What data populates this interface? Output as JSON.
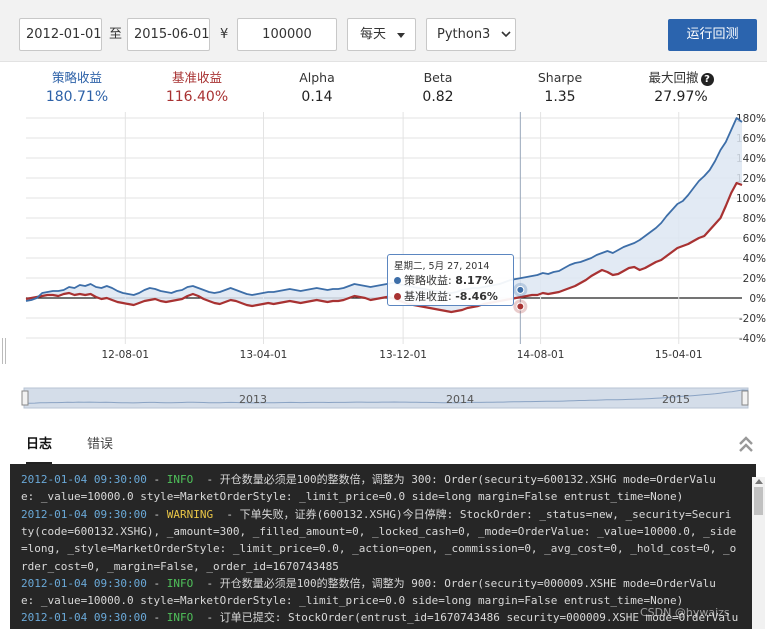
{
  "toolbar": {
    "start_date": "2012-01-01",
    "to_label": "至",
    "end_date": "2015-06-01",
    "currency_symbol": "¥",
    "capital": "100000",
    "frequency": "每天",
    "language": "Python3",
    "run_button": "运行回测"
  },
  "stats": [
    {
      "label": "策略收益",
      "value": "180.71%",
      "color": "#2e62a8"
    },
    {
      "label": "基准收益",
      "value": "116.40%",
      "color": "#a83232"
    },
    {
      "label": "Alpha",
      "value": "0.14",
      "color": "#222222"
    },
    {
      "label": "Beta",
      "value": "0.82",
      "color": "#222222"
    },
    {
      "label": "Sharpe",
      "value": "1.35",
      "color": "#222222"
    },
    {
      "label": "最大回撤",
      "value": "27.97%",
      "color": "#222222"
    }
  ],
  "chart_data": {
    "type": "line",
    "y_unit": "%",
    "ylim": [
      -40,
      180
    ],
    "yticks": [
      "-40%",
      "-20%",
      "0%",
      "20%",
      "40%",
      "60%",
      "80%",
      "100%",
      "120%",
      "140%",
      "160%",
      "180%"
    ],
    "xticks": [
      "12-08-01",
      "13-04-01",
      "13-12-01",
      "14-08-01",
      "15-04-01"
    ],
    "navigator_labels": [
      "2013",
      "2014",
      "2015"
    ],
    "grid": true,
    "legend": "none",
    "colors": {
      "strategy": "#3d6ea8",
      "benchmark": "#a83232",
      "area": "#dde6f2"
    },
    "series": [
      {
        "name": "策略收益",
        "points": [
          [
            0,
            -3
          ],
          [
            1,
            -2
          ],
          [
            2,
            0
          ],
          [
            3,
            5
          ],
          [
            4,
            6
          ],
          [
            5,
            7
          ],
          [
            6,
            7
          ],
          [
            7,
            8
          ],
          [
            8,
            11
          ],
          [
            9,
            10
          ],
          [
            10,
            13
          ],
          [
            11,
            12
          ],
          [
            12,
            14
          ],
          [
            13,
            11
          ],
          [
            14,
            10
          ],
          [
            15,
            12
          ],
          [
            16,
            10
          ],
          [
            17,
            7
          ],
          [
            18,
            5
          ],
          [
            19,
            4
          ],
          [
            20,
            3
          ],
          [
            21,
            5
          ],
          [
            22,
            8
          ],
          [
            23,
            10
          ],
          [
            24,
            9
          ],
          [
            25,
            7
          ],
          [
            26,
            6
          ],
          [
            27,
            5
          ],
          [
            28,
            7
          ],
          [
            29,
            8
          ],
          [
            30,
            11
          ],
          [
            31,
            12
          ],
          [
            32,
            10
          ],
          [
            33,
            8
          ],
          [
            34,
            6
          ],
          [
            35,
            5
          ],
          [
            36,
            6
          ],
          [
            37,
            8
          ],
          [
            38,
            10
          ],
          [
            39,
            8
          ],
          [
            40,
            6
          ],
          [
            41,
            4
          ],
          [
            42,
            3
          ],
          [
            43,
            4
          ],
          [
            44,
            5
          ],
          [
            45,
            6
          ],
          [
            46,
            6
          ],
          [
            47,
            7
          ],
          [
            48,
            8
          ],
          [
            49,
            9
          ],
          [
            50,
            8
          ],
          [
            51,
            7
          ],
          [
            52,
            8
          ],
          [
            53,
            9
          ],
          [
            54,
            10
          ],
          [
            55,
            9
          ],
          [
            56,
            8
          ],
          [
            57,
            9
          ],
          [
            58,
            9
          ],
          [
            59,
            10
          ],
          [
            60,
            12
          ],
          [
            61,
            14
          ],
          [
            62,
            13
          ],
          [
            63,
            12
          ],
          [
            64,
            11
          ],
          [
            65,
            12
          ],
          [
            66,
            13
          ],
          [
            67,
            14
          ],
          [
            68,
            15
          ],
          [
            69,
            14
          ],
          [
            70,
            13
          ],
          [
            71,
            12
          ],
          [
            72,
            11
          ],
          [
            73,
            10
          ],
          [
            74,
            9
          ],
          [
            75,
            8
          ],
          [
            76,
            7
          ],
          [
            77,
            6
          ],
          [
            78,
            5
          ],
          [
            79,
            5
          ],
          [
            80,
            6
          ],
          [
            81,
            8
          ],
          [
            82,
            9
          ],
          [
            83,
            10
          ],
          [
            84,
            10
          ],
          [
            85,
            11
          ],
          [
            86,
            12
          ],
          [
            87,
            13
          ],
          [
            88,
            14
          ],
          [
            89,
            16
          ],
          [
            90,
            18
          ],
          [
            91,
            19
          ],
          [
            92,
            20
          ],
          [
            93,
            21
          ],
          [
            94,
            22
          ],
          [
            95,
            23
          ],
          [
            96,
            25
          ],
          [
            97,
            24
          ],
          [
            98,
            26
          ],
          [
            99,
            27
          ],
          [
            100,
            30
          ],
          [
            101,
            33
          ],
          [
            102,
            35
          ],
          [
            103,
            36
          ],
          [
            104,
            38
          ],
          [
            105,
            40
          ],
          [
            106,
            43
          ],
          [
            107,
            45
          ],
          [
            108,
            47
          ],
          [
            109,
            45
          ],
          [
            110,
            48
          ],
          [
            111,
            51
          ],
          [
            112,
            53
          ],
          [
            113,
            55
          ],
          [
            114,
            58
          ],
          [
            115,
            62
          ],
          [
            116,
            66
          ],
          [
            117,
            70
          ],
          [
            118,
            75
          ],
          [
            119,
            82
          ],
          [
            120,
            88
          ],
          [
            121,
            94
          ],
          [
            122,
            97
          ],
          [
            123,
            103
          ],
          [
            124,
            110
          ],
          [
            125,
            117
          ],
          [
            126,
            122
          ],
          [
            127,
            128
          ],
          [
            128,
            137
          ],
          [
            129,
            148
          ],
          [
            130,
            156
          ],
          [
            131,
            168
          ],
          [
            132,
            180
          ],
          [
            133,
            176
          ]
        ]
      },
      {
        "name": "基准收益",
        "points": [
          [
            0,
            -1
          ],
          [
            1,
            0
          ],
          [
            2,
            1
          ],
          [
            3,
            2
          ],
          [
            4,
            3
          ],
          [
            5,
            3
          ],
          [
            6,
            2
          ],
          [
            7,
            4
          ],
          [
            8,
            5
          ],
          [
            9,
            3
          ],
          [
            10,
            4
          ],
          [
            11,
            3
          ],
          [
            12,
            4
          ],
          [
            13,
            1
          ],
          [
            14,
            -1
          ],
          [
            15,
            0
          ],
          [
            16,
            -2
          ],
          [
            17,
            -4
          ],
          [
            18,
            -5
          ],
          [
            19,
            -6
          ],
          [
            20,
            -7
          ],
          [
            21,
            -5
          ],
          [
            22,
            -3
          ],
          [
            23,
            -2
          ],
          [
            24,
            -1
          ],
          [
            25,
            -3
          ],
          [
            26,
            -4
          ],
          [
            27,
            -3
          ],
          [
            28,
            -2
          ],
          [
            29,
            -1
          ],
          [
            30,
            2
          ],
          [
            31,
            4
          ],
          [
            32,
            2
          ],
          [
            33,
            -1
          ],
          [
            34,
            -3
          ],
          [
            35,
            -5
          ],
          [
            36,
            -6
          ],
          [
            37,
            -4
          ],
          [
            38,
            -2
          ],
          [
            39,
            -3
          ],
          [
            40,
            -5
          ],
          [
            41,
            -7
          ],
          [
            42,
            -8
          ],
          [
            43,
            -7
          ],
          [
            44,
            -6
          ],
          [
            45,
            -5
          ],
          [
            46,
            -6
          ],
          [
            47,
            -5
          ],
          [
            48,
            -4
          ],
          [
            49,
            -3
          ],
          [
            50,
            -4
          ],
          [
            51,
            -5
          ],
          [
            52,
            -4
          ],
          [
            53,
            -3
          ],
          [
            54,
            -2
          ],
          [
            55,
            -3
          ],
          [
            56,
            -4
          ],
          [
            57,
            -3
          ],
          [
            58,
            -3
          ],
          [
            59,
            -2
          ],
          [
            60,
            0
          ],
          [
            61,
            2
          ],
          [
            62,
            1
          ],
          [
            63,
            0
          ],
          [
            64,
            -2
          ],
          [
            65,
            -1
          ],
          [
            66,
            0
          ],
          [
            67,
            1
          ],
          [
            68,
            0
          ],
          [
            69,
            -2
          ],
          [
            70,
            -4
          ],
          [
            71,
            -6
          ],
          [
            72,
            -7
          ],
          [
            73,
            -8
          ],
          [
            74,
            -9
          ],
          [
            75,
            -10
          ],
          [
            76,
            -11
          ],
          [
            77,
            -12
          ],
          [
            78,
            -13
          ],
          [
            79,
            -14
          ],
          [
            80,
            -13
          ],
          [
            81,
            -12
          ],
          [
            82,
            -10
          ],
          [
            83,
            -9
          ],
          [
            84,
            -8
          ],
          [
            85,
            -6
          ],
          [
            86,
            -5
          ],
          [
            87,
            -4
          ],
          [
            88,
            -3
          ],
          [
            89,
            -2
          ],
          [
            90,
            -1
          ],
          [
            91,
            0
          ],
          [
            92,
            1
          ],
          [
            93,
            2
          ],
          [
            94,
            3
          ],
          [
            95,
            3
          ],
          [
            96,
            5
          ],
          [
            97,
            4
          ],
          [
            98,
            5
          ],
          [
            99,
            6
          ],
          [
            100,
            8
          ],
          [
            101,
            10
          ],
          [
            102,
            12
          ],
          [
            103,
            15
          ],
          [
            104,
            18
          ],
          [
            105,
            22
          ],
          [
            106,
            25
          ],
          [
            107,
            28
          ],
          [
            108,
            26
          ],
          [
            109,
            23
          ],
          [
            110,
            24
          ],
          [
            111,
            27
          ],
          [
            112,
            30
          ],
          [
            113,
            31
          ],
          [
            114,
            28
          ],
          [
            115,
            30
          ],
          [
            116,
            33
          ],
          [
            117,
            36
          ],
          [
            118,
            38
          ],
          [
            119,
            42
          ],
          [
            120,
            46
          ],
          [
            121,
            50
          ],
          [
            122,
            52
          ],
          [
            123,
            54
          ],
          [
            124,
            57
          ],
          [
            125,
            60
          ],
          [
            126,
            62
          ],
          [
            127,
            68
          ],
          [
            128,
            74
          ],
          [
            129,
            80
          ],
          [
            130,
            92
          ],
          [
            131,
            105
          ],
          [
            132,
            115
          ],
          [
            133,
            113
          ]
        ]
      }
    ],
    "tooltip": {
      "date": "星期二, 5月 27, 2014",
      "rows": [
        {
          "name": "策略收益:",
          "value": "8.17%"
        },
        {
          "name": "基准收益:",
          "value": "-8.46%"
        }
      ]
    }
  },
  "log": {
    "tabs": [
      "日志",
      "错误"
    ],
    "lines": [
      [
        {
          "t": "2012-01-04 09:30:00",
          "c": "ts"
        },
        {
          "t": " - ",
          "c": ""
        },
        {
          "t": "INFO",
          "c": "lv-info"
        },
        {
          "t": "  - 开仓数量必须是100的整数倍，调整为 300: Order(security=600132.XSHG mode=OrderValu",
          "c": ""
        }
      ],
      [
        {
          "t": "e: _value=10000.0 style=MarketOrderStyle: _limit_price=0.0 side=long margin=False entrust_time=None)",
          "c": ""
        }
      ],
      [
        {
          "t": "2012-01-04 09:30:00",
          "c": "ts"
        },
        {
          "t": " - ",
          "c": ""
        },
        {
          "t": "WARNING",
          "c": "lv-warn"
        },
        {
          "t": "  - 下单失败，证券(600132.XSHG)今日停牌: StockOrder: _status=new, _security=Securi",
          "c": ""
        }
      ],
      [
        {
          "t": "ty(code=600132.XSHG), _amount=300, _filled_amount=0, _locked_cash=0, _mode=OrderValue: _value=10000.0, _side",
          "c": ""
        }
      ],
      [
        {
          "t": "=long, _style=MarketOrderStyle: _limit_price=0.0, _action=open, _commission=0, _avg_cost=0, _hold_cost=0, _o",
          "c": ""
        }
      ],
      [
        {
          "t": "rder_cost=0, _margin=False, _order_id=1670743485",
          "c": ""
        }
      ],
      [
        {
          "t": "2012-01-04 09:30:00",
          "c": "ts"
        },
        {
          "t": " - ",
          "c": ""
        },
        {
          "t": "INFO",
          "c": "lv-info"
        },
        {
          "t": "  - 开仓数量必须是100的整数倍，调整为 900: Order(security=000009.XSHE mode=OrderValu",
          "c": ""
        }
      ],
      [
        {
          "t": "e: _value=10000.0 style=MarketOrderStyle: _limit_price=0.0 side=long margin=False entrust_time=None)",
          "c": ""
        }
      ],
      [
        {
          "t": "2012-01-04 09:30:00",
          "c": "ts"
        },
        {
          "t": " - ",
          "c": ""
        },
        {
          "t": "INFO",
          "c": "lv-info"
        },
        {
          "t": "  - 订单已提交: StockOrder(entrust_id=1670743486 security=000009.XSHE mode=OrderValu",
          "c": ""
        }
      ]
    ],
    "watermark": "CSDN @hywaizs"
  }
}
